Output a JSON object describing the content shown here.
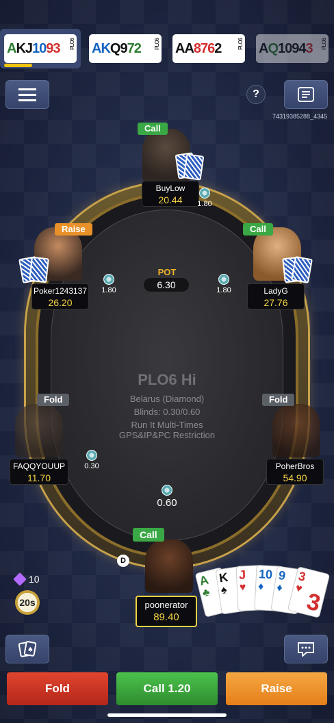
{
  "tabs": [
    {
      "cards": [
        {
          "r": "A",
          "c": "g"
        },
        {
          "r": "K",
          "c": "k"
        },
        {
          "r": "J",
          "c": "k"
        },
        {
          "r": "10",
          "c": "b"
        },
        {
          "r": "9",
          "c": "r"
        },
        {
          "r": "3",
          "c": "r"
        }
      ],
      "tag": "PLO6",
      "active": true,
      "timer_progress": 0.35
    },
    {
      "cards": [
        {
          "r": "A",
          "c": "b"
        },
        {
          "r": "K",
          "c": "b"
        },
        {
          "r": "Q",
          "c": "k"
        },
        {
          "r": "9",
          "c": "k"
        },
        {
          "r": "7",
          "c": "g"
        },
        {
          "r": "2",
          "c": "g"
        }
      ],
      "tag": "PLO6",
      "active": false
    },
    {
      "cards": [
        {
          "r": "A",
          "c": "k"
        },
        {
          "r": "A",
          "c": "k"
        },
        {
          "r": "8",
          "c": "r"
        },
        {
          "r": "7",
          "c": "r"
        },
        {
          "r": "6",
          "c": "r"
        },
        {
          "r": "2",
          "c": "k"
        }
      ],
      "tag": "PLO6",
      "active": false
    },
    {
      "cards": [
        {
          "r": "A",
          "c": "k"
        },
        {
          "r": "Q",
          "c": "g"
        },
        {
          "r": "10",
          "c": "k"
        },
        {
          "r": "9",
          "c": "k"
        },
        {
          "r": "4",
          "c": "k"
        },
        {
          "r": "3",
          "c": "r"
        }
      ],
      "tag": "PLO6",
      "active": false,
      "faded": true
    }
  ],
  "hand_id": "74319385288_4345",
  "table": {
    "game_name": "PLO6 Hi",
    "info_lines": [
      "Belarus (Diamond)",
      "Blinds: 0.30/0.60",
      "Run It Multi-Times",
      "GPS&IP&PC Restriction"
    ],
    "pot_label": "POT",
    "pot_value": "6.30"
  },
  "seats": [
    {
      "name": "BuyLow",
      "stack": "20.44",
      "action": "Call",
      "bet": "1.80"
    },
    {
      "name": "Poker1243137",
      "stack": "26.20",
      "action": "Raise",
      "bet": "1.80"
    },
    {
      "name": "LadyG",
      "stack": "27.76",
      "action": "Call",
      "bet": "1.80"
    },
    {
      "name": "FAQQYOUUP",
      "stack": "11.70",
      "action": "Fold",
      "bet": "0.30"
    },
    {
      "name": "PoherBros",
      "stack": "54.90",
      "action": "Fold"
    },
    {
      "name": "poonerator",
      "stack": "89.40",
      "action": "Call",
      "bet": "0.60"
    }
  ],
  "dealer_label": "D",
  "hero_cards": [
    {
      "r": "A",
      "s": "♣",
      "c": "g"
    },
    {
      "r": "K",
      "s": "♠",
      "c": "k"
    },
    {
      "r": "J",
      "s": "♥",
      "c": "r"
    },
    {
      "r": "10",
      "s": "♦",
      "c": "b"
    },
    {
      "r": "9",
      "s": "♦",
      "c": "b"
    },
    {
      "r": "3",
      "s": "♥",
      "c": "r"
    }
  ],
  "gems": "10",
  "timer": "20s",
  "buttons": {
    "fold": "Fold",
    "call": "Call 1.20",
    "raise": "Raise"
  },
  "icons": {
    "menu": "hamburger-menu-icon",
    "help": "help-icon",
    "history": "hand-history-icon",
    "cards": "cards-icon",
    "chat": "chat-icon"
  }
}
